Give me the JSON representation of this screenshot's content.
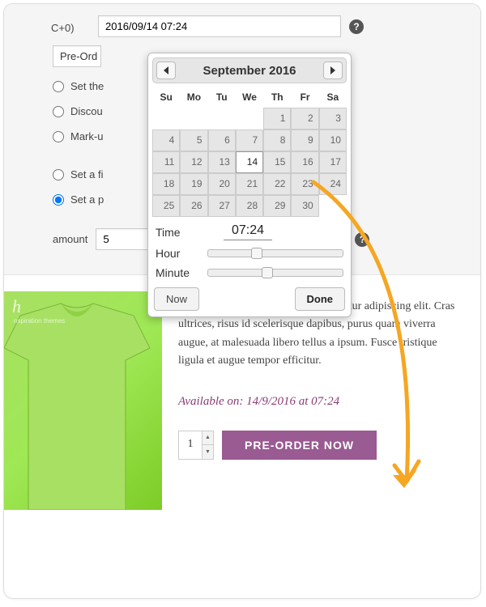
{
  "tz_suffix": "C+0)",
  "date_value": "2016/09/14 07:24",
  "select_truncated": "Pre-Ord",
  "radios": {
    "r1": "Set the",
    "r2": "Discou",
    "r3": "Mark-u",
    "r4": "Set a fi",
    "r5": "Set a p"
  },
  "amount_label": "amount",
  "amount_value": "5",
  "datepicker": {
    "title": "September 2016",
    "dow": [
      "Su",
      "Mo",
      "Tu",
      "We",
      "Th",
      "Fr",
      "Sa"
    ],
    "days": [
      [
        "",
        "",
        "",
        "",
        "1",
        "2",
        "3"
      ],
      [
        "4",
        "5",
        "6",
        "7",
        "8",
        "9",
        "10"
      ],
      [
        "11",
        "12",
        "13",
        "14",
        "15",
        "16",
        "17"
      ],
      [
        "18",
        "19",
        "20",
        "21",
        "22",
        "23",
        "24"
      ],
      [
        "25",
        "26",
        "27",
        "28",
        "29",
        "30",
        ""
      ]
    ],
    "selected_day": "14",
    "time_label": "Time",
    "time_value": "07:24",
    "hour_label": "Hour",
    "minute_label": "Minute",
    "now_btn": "Now",
    "done_btn": "Done",
    "hour_pos_pct": 32,
    "minute_pos_pct": 40
  },
  "product": {
    "watermark": "h",
    "watermark_sub": "nspiration themes",
    "description": "Lorem ipsum dolor sit amet, consectetur adipiscing elit. Cras ultrices, risus id scelerisque dapibus, purus quam viverra augue, at malesuada libero tellus a ipsum. Fusce tristique ligula et augue tempor efficitur.",
    "available_text": "Available on: 14/9/2016 at 07:24",
    "qty": "1",
    "button_label": "PRE-ORDER NOW"
  },
  "colors": {
    "accent_purple": "#8a3d77",
    "button_purple": "#9a5a92",
    "arrow_orange": "#f5a623"
  }
}
